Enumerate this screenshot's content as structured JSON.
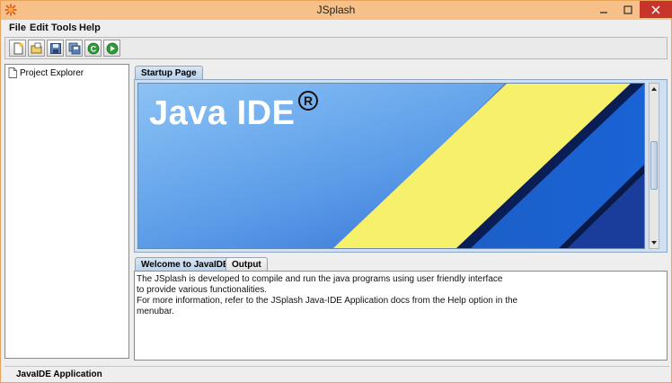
{
  "window": {
    "title": "JSplash"
  },
  "menubar": {
    "items": [
      "File",
      "Edit",
      "Tools",
      "Help"
    ]
  },
  "toolbar": {
    "buttons": [
      "new-file-icon",
      "open-folder-icon",
      "save-icon",
      "save-all-icon",
      "compile-icon",
      "run-icon"
    ]
  },
  "explorer": {
    "root_label": "Project Explorer"
  },
  "editor_tabs": {
    "startup_label": "Startup Page"
  },
  "banner": {
    "title": "Java IDE",
    "reg_mark": "R"
  },
  "bottom_tabs": {
    "welcome_label": "Welcome to JavaIDE",
    "output_label": "Output"
  },
  "welcome": {
    "lines": [
      "The JSplash is developed to compile and run the java programs using user friendly interface",
      "to provide various functionalities.",
      "For more information, refer to the JSplash Java-IDE Application docs from the Help option in the",
      "menubar."
    ]
  },
  "status": {
    "text": "JavaIDE Application"
  },
  "colors": {
    "title_bar": "#f6c088",
    "close_button": "#c7342a",
    "banner_blue": "#3a7be0",
    "banner_yellow": "#f7f06a"
  }
}
